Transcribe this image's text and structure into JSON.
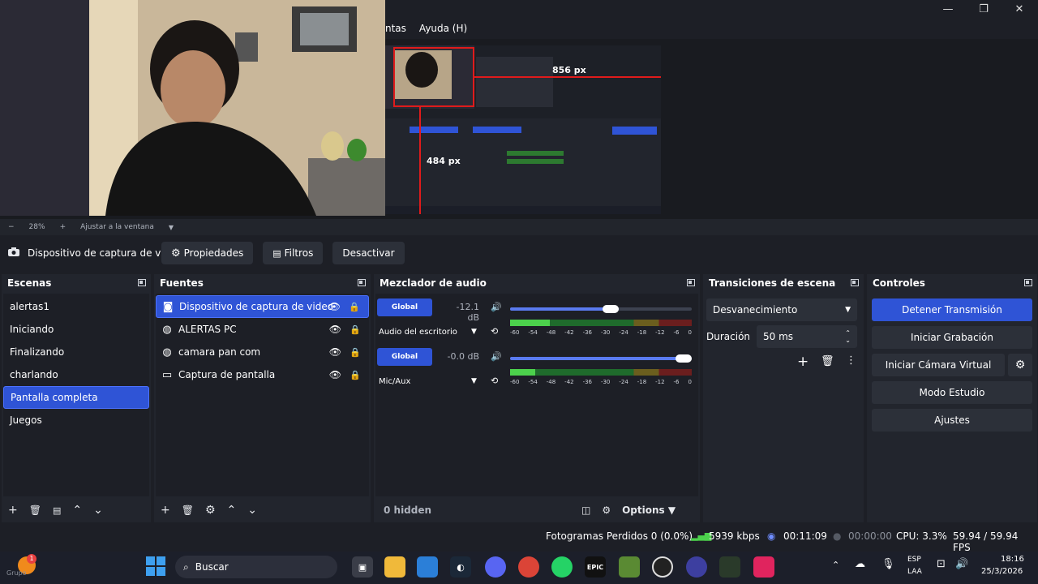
{
  "window": {
    "minimize_glyph": "—",
    "restore_glyph": "❐",
    "close_glyph": "✕"
  },
  "menubar": {
    "items": [
      "ntas",
      "Ayuda (H)"
    ]
  },
  "preview": {
    "width_label": "856 px",
    "height_label": "484 px"
  },
  "zoom": {
    "minus": "−",
    "value": "28%",
    "plus": "+",
    "fit_label": "Ajustar a la ventana"
  },
  "source_toolbar": {
    "source_name": "Dispositivo de captura de v",
    "properties_label": "Propiedades",
    "filters_label": "Filtros",
    "deactivate_label": "Desactivar"
  },
  "scenes": {
    "title": "Escenas",
    "items": [
      "alertas1",
      "Iniciando",
      "Finalizando",
      "charlando",
      "Pantalla completa",
      "Juegos"
    ],
    "selected_index": 4
  },
  "sources": {
    "title": "Fuentes",
    "items": [
      {
        "label": "Dispositivo de captura de video",
        "icon": "camera-icon",
        "selected": true
      },
      {
        "label": "ALERTAS PC",
        "icon": "browser-icon",
        "selected": false
      },
      {
        "label": "camara pan com",
        "icon": "browser-icon",
        "selected": false
      },
      {
        "label": "Captura de pantalla",
        "icon": "monitor-icon",
        "selected": false
      }
    ]
  },
  "mixer": {
    "title": "Mezclador de audio",
    "channels": [
      {
        "global_label": "Global",
        "db": "-12.1 dB",
        "name": "Audio del escritorio",
        "volume": 0.6,
        "level": 0.22
      },
      {
        "global_label": "Global",
        "db": "-0.0 dB",
        "name": "Mic/Aux",
        "volume": 1.0,
        "level": 0.14
      }
    ],
    "scale": [
      "-60",
      "-54",
      "-48",
      "-42",
      "-36",
      "-30",
      "-24",
      "-18",
      "-12",
      "-6",
      "0"
    ],
    "hidden_label": "0 hidden",
    "options_label": "Options"
  },
  "transitions": {
    "title": "Transiciones de escena",
    "selected": "Desvanecimiento",
    "duration_label": "Duración",
    "duration_value": "50 ms"
  },
  "controls": {
    "title": "Controles",
    "buttons": [
      "Detener Transmisión",
      "Iniciar Grabación",
      "Iniciar Cámara Virtual",
      "Modo Estudio",
      "Ajustes"
    ]
  },
  "status": {
    "dropped": "Fotogramas Perdidos 0 (0.0%)",
    "bitrate": "5939 kbps",
    "stream_time": "00:11:09",
    "rec_time": "00:00:00",
    "cpu": "CPU: 3.3%",
    "fps": "59.94 / 59.94 FPS"
  },
  "taskbar": {
    "search_placeholder": "Buscar",
    "start_label": "Grupo",
    "lang_top": "ESP",
    "lang_bottom": "LAA",
    "time": "18:16",
    "date": "25/3/2026",
    "notification_count": "1"
  },
  "colors": {
    "accent": "#2f54d6",
    "dock_bg": "#22252d",
    "window_bg": "#1d1f26",
    "record_red": "#e01b1b"
  }
}
